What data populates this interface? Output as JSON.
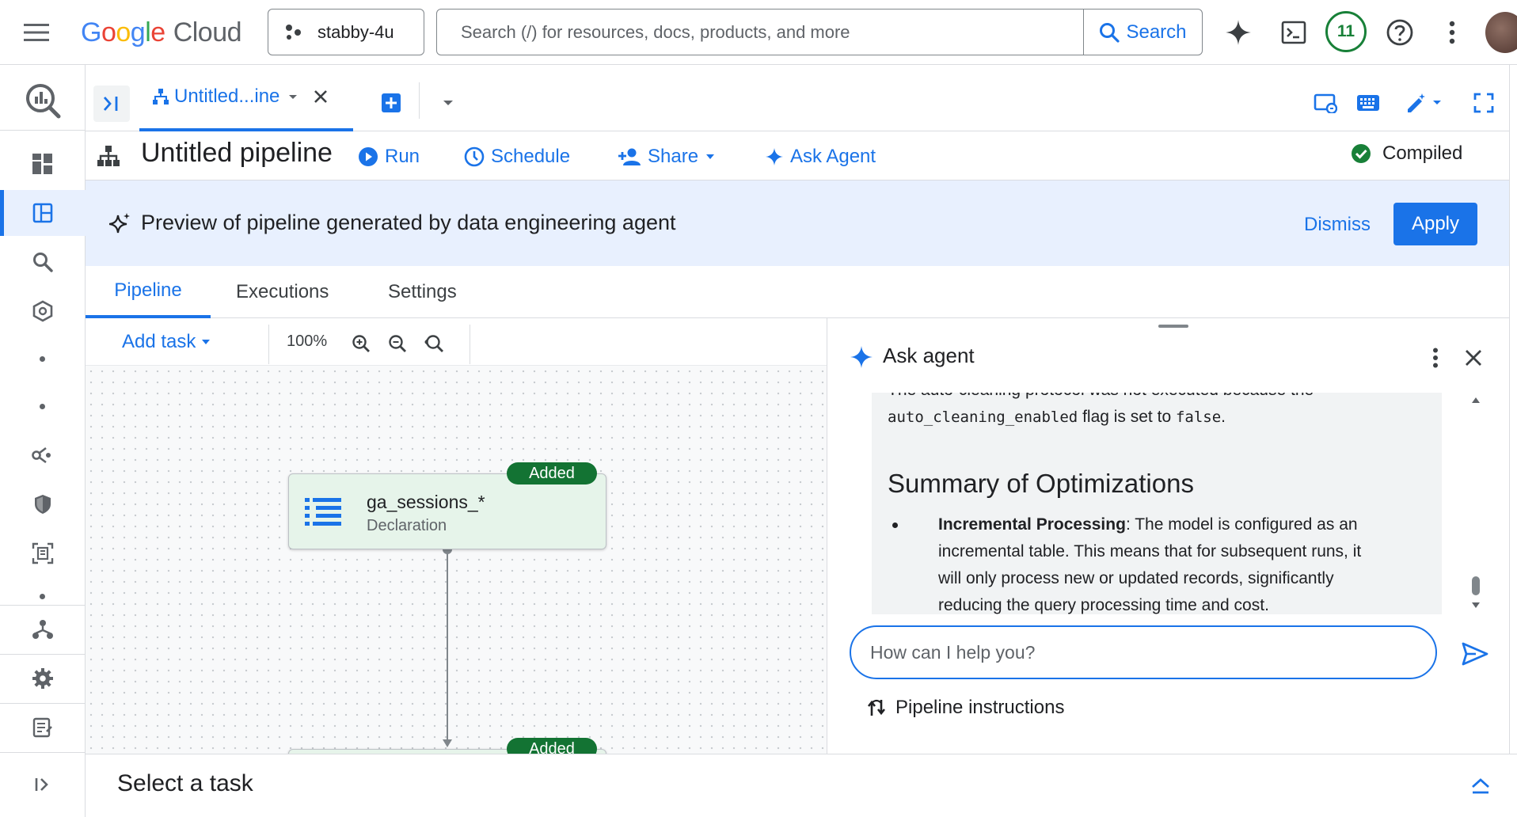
{
  "topbar": {
    "logo_letters": [
      "G",
      "o",
      "o",
      "g",
      "l",
      "e"
    ],
    "logo_cloud": "Cloud",
    "project_name": "stabby-4u",
    "search_placeholder": "Search (/) for resources, docs, products, and more",
    "search_button": "Search",
    "notifications_count": "11"
  },
  "editor": {
    "tab_label": "Untitled...ine"
  },
  "pipeline": {
    "title": "Untitled pipeline",
    "run": "Run",
    "schedule": "Schedule",
    "share": "Share",
    "ask_agent": "Ask Agent",
    "status": "Compiled"
  },
  "banner": {
    "text": "Preview of pipeline generated by data engineering agent",
    "dismiss": "Dismiss",
    "apply": "Apply"
  },
  "subtabs": [
    "Pipeline",
    "Executions",
    "Settings"
  ],
  "canvas": {
    "add_task": "Add task",
    "zoom": "100%",
    "nodes": [
      {
        "title": "ga_sessions_*",
        "subtitle": "Declaration",
        "badge": "Added"
      },
      {
        "title": "",
        "subtitle": "",
        "badge": "Added"
      }
    ]
  },
  "agent": {
    "title": "Ask agent",
    "partial_line": "The auto-cleaning protocol was not executed because the",
    "flag_name": "auto_cleaning_enabled",
    "flag_mid": "flag is set to",
    "flag_value": "false",
    "flag_end": ".",
    "heading": "Summary of Optimizations",
    "bullet_term": "Incremental Processing",
    "bullet_line1": ": The model is configured as an",
    "bullet_line2": "incremental table. This means that for subsequent runs, it",
    "bullet_line3": "will only process new or updated records, significantly",
    "bullet_line4": "reducing the query processing time and cost.",
    "input_placeholder": "How can I help you?",
    "pipeline_instructions": "Pipeline instructions"
  },
  "bottom": {
    "select_task": "Select a task"
  },
  "colors": {
    "accent": "#1a73e8",
    "banner_bg": "#e8f0fe",
    "added_green": "#137333",
    "node_bg": "#e6f4ea",
    "compiled_green": "#188038"
  }
}
